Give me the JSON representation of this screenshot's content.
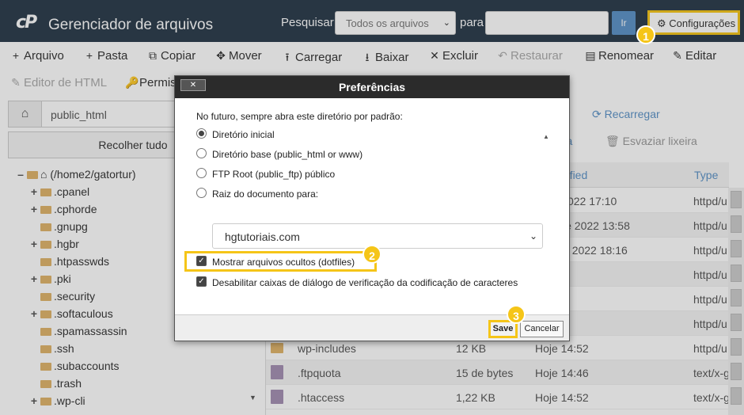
{
  "header": {
    "logo": "cP",
    "title": "Gerenciador de arquivos",
    "search_label": "Pesquisar",
    "search_scope": "Todos os arquivos",
    "para_label": "para",
    "go_label": "Ir",
    "settings_label": "Configurações"
  },
  "toolbar_row1": [
    {
      "icon": "+",
      "label": "Arquivo"
    },
    {
      "icon": "+",
      "label": "Pasta"
    },
    {
      "icon": "⧉",
      "label": "Copiar"
    },
    {
      "icon": "✥",
      "label": "Mover"
    },
    {
      "icon": "⭱",
      "label": "Carregar"
    },
    {
      "icon": "⭳",
      "label": "Baixar"
    },
    {
      "icon": "✕",
      "label": "Excluir"
    },
    {
      "icon": "↶",
      "label": "Restaurar"
    },
    {
      "icon": "▤",
      "label": "Renomear"
    },
    {
      "icon": "✎",
      "label": "Editar"
    }
  ],
  "toolbar_row2": [
    {
      "icon": "✎",
      "label": "Editor de HTML"
    },
    {
      "icon": "🔑",
      "label": "Permis"
    }
  ],
  "left": {
    "path": "public_html",
    "collapse_label": "Recolher tudo",
    "tree": [
      {
        "label": "(/home2/gatortur)",
        "expander": "–",
        "root": true
      },
      {
        "label": ".cpanel",
        "expander": "+"
      },
      {
        "label": ".cphorde",
        "expander": "+"
      },
      {
        "label": ".gnupg",
        "expander": ""
      },
      {
        "label": ".hgbr",
        "expander": "+"
      },
      {
        "label": ".htpasswds",
        "expander": ""
      },
      {
        "label": ".pki",
        "expander": "+"
      },
      {
        "label": ".security",
        "expander": ""
      },
      {
        "label": ".softaculous",
        "expander": "+"
      },
      {
        "label": ".spamassassin",
        "expander": ""
      },
      {
        "label": ".ssh",
        "expander": ""
      },
      {
        "label": ".subaccounts",
        "expander": ""
      },
      {
        "label": ".trash",
        "expander": ""
      },
      {
        "label": ".wp-cli",
        "expander": "+"
      }
    ]
  },
  "right": {
    "partial_action": "har",
    "reload_label": "Recarregar",
    "partial_trash": "eira",
    "empty_trash_label": "Esvaziar lixeira",
    "col_modified": "odified",
    "col_type": "Type",
    "rows": [
      {
        "icon": "",
        "name": "",
        "size": "",
        "modified": "v. de 2022 17:10",
        "type": "httpd/u"
      },
      {
        "icon": "",
        "name": "",
        "size": "",
        "modified": "mai. de 2022 13:58",
        "type": "httpd/u"
      },
      {
        "icon": "",
        "name": "",
        "size": "",
        "modified": "abr. de 2022 18:16",
        "type": "httpd/u"
      },
      {
        "icon": "",
        "name": "",
        "size": "",
        "modified": "18:30",
        "type": "httpd/u"
      },
      {
        "icon": "",
        "name": "",
        "size": "",
        "modified": "4:52",
        "type": "httpd/u"
      },
      {
        "icon": "",
        "name": "",
        "size": "",
        "modified": "4:52",
        "type": "httpd/u"
      },
      {
        "icon": "folder",
        "name": "wp-includes",
        "size": "12 KB",
        "modified": "Hoje 14:52",
        "type": "httpd/u"
      },
      {
        "icon": "file",
        "name": ".ftpquota",
        "size": "15 de bytes",
        "modified": "Hoje 14:46",
        "type": "text/x-g"
      },
      {
        "icon": "file",
        "name": ".htaccess",
        "size": "1,22 KB",
        "modified": "Hoje 14:52",
        "type": "text/x-g"
      }
    ]
  },
  "dialog": {
    "title": "Preferências",
    "close_label": "✕",
    "default_dir_prompt": "No futuro, sempre abra este diretório por padrão:",
    "options": [
      {
        "label": "Diretório inicial",
        "checked": true
      },
      {
        "label": "Diretório base (public_html or www)",
        "checked": false
      },
      {
        "label": "FTP Root (public_ftp) público",
        "checked": false
      },
      {
        "label": "Raiz do documento para:",
        "checked": false
      }
    ],
    "docroot_value": "hgtutoriais.com",
    "show_hidden_label": "Mostrar arquivos ocultos (dotfiles)",
    "disable_encoding_label": "Desabilitar caixas de diálogo de verificação da codificação de caracteres",
    "save_label": "Save",
    "cancel_label": "Cancelar"
  },
  "markers": [
    "1",
    "2",
    "3"
  ],
  "colors": {
    "header_bg": "#293a4a",
    "highlight": "#f5c518",
    "link": "#5b92c7"
  }
}
